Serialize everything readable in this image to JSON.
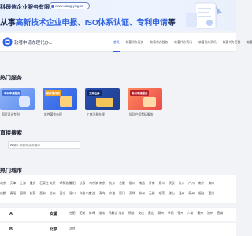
{
  "banner": {
    "company": "科臻信企业服务有限公司",
    "url": "www.xiang-ying.cn",
    "headline_prefix": "从事",
    "headline_highlight": "高新技术企业申报、ISO体系认证、专利申请",
    "headline_suffix": "等"
  },
  "navbar": {
    "site_name": "软著申请办理代办...",
    "items": [
      {
        "label": "首页",
        "active": true
      },
      {
        "label": "软著代办服务"
      },
      {
        "label": "软著代办服务"
      },
      {
        "label": "软著代办资讯"
      },
      {
        "label": "软著代办资讯"
      },
      {
        "label": "软著代办百科"
      },
      {
        "label": "软著代办百科"
      }
    ]
  },
  "services": {
    "title": "热门服务",
    "cards": [
      {
        "tag": "专利申请服务",
        "label": "国家设计专利",
        "color": "#5b8df0"
      },
      {
        "tag": "软件著作权",
        "label": "软件著作办理",
        "color": "#2f63e0"
      },
      {
        "tag": "工商注册",
        "label": "工商注册办理",
        "color": "#1f3f8e"
      },
      {
        "tag": "专利申请服务",
        "label": "知识产权贯标服务",
        "color": "#e84a4a"
      }
    ]
  },
  "search": {
    "title": "直接搜索",
    "placeholder": "输入你要申请的城市"
  },
  "cities": {
    "title": "热门城市",
    "row1": [
      "北京",
      "天津",
      "上海",
      "重庆",
      "石家庄",
      "太原",
      "呼和浩特",
      "沈阳",
      "长春",
      "哈尔滨",
      "南京",
      "杭州",
      "合肥",
      "福州",
      "南昌",
      "济南",
      "郑州",
      "武汉",
      "长沙",
      "广州",
      "南宁",
      "海口"
    ],
    "row2": [
      "成都",
      "贵阳",
      "昆明",
      "拉萨",
      "西安",
      "兰州",
      "西宁",
      "银川",
      "乌鲁木齐",
      "大连",
      "青岛",
      "宁波",
      "厦门",
      "深圳",
      "苏州",
      "无锡",
      "东莞",
      "佛山",
      "温州",
      "泉州",
      "烟台",
      "嘉兴"
    ]
  },
  "alphabet": [
    {
      "letter": "A",
      "province": "安徽",
      "cities": [
        "合肥",
        "芜湖",
        "蚌埠",
        "淮南",
        "马鞍山",
        "淮北",
        "铜陵",
        "安庆",
        "黄山",
        "滁州",
        "阜阳",
        "宿州",
        "六安",
        "亳州",
        "池州",
        "宣城"
      ]
    },
    {
      "letter": "B",
      "province": "北京",
      "cities": [
        "北京"
      ]
    }
  ]
}
